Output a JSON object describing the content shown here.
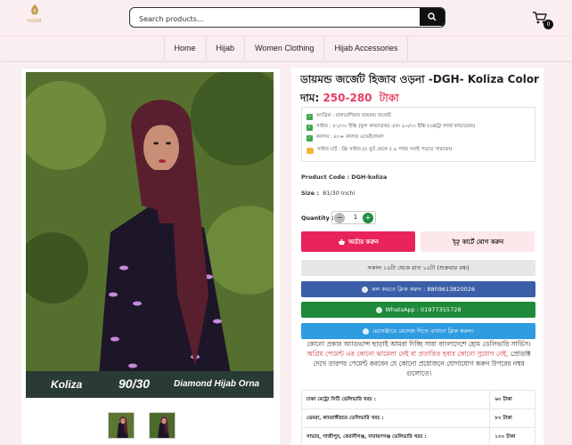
{
  "brand": {
    "logo_text": "HIJAB"
  },
  "search": {
    "placeholder": "Search products..."
  },
  "cart": {
    "count": "0"
  },
  "nav": {
    "items": [
      "Home",
      "Hijab",
      "Women Clothing",
      "Hijab Accessories"
    ]
  },
  "product": {
    "title": "ডায়মন্ড জর্জেট হিজাব ওড়না -DGH- Koliza Color",
    "price_label": "দাম:",
    "price": "250-280",
    "currency": "টাকা",
    "features": [
      "ফ্যাব্রিক : মালয়েশিয়ান ডায়মন্ড জর্জেট",
      "সাইজ : ৮১/৩০ ইঞ্চি (ফুল কাভারেজ) এবং ৯০/৩০ ইঞ্চি (এক্সট্রা লার্জ কাভারেজ)",
      "কালার : ৪০+ কালার এভেইলেবল"
    ],
    "size_note": "সাইজ চার্ট : ফ্রি সাইজ (৫ ফুট থেকে ৫.৯ পর্যন্ত সবাই পড়তে পারবেন)",
    "product_code_label": "Product Code :",
    "product_code": "DGH-koliza",
    "size_label": "Size :",
    "size_value": "81/30 Inchi",
    "quantity_label": "Quantity :",
    "quantity": "1"
  },
  "image": {
    "caption_left": "Koliza",
    "caption_mid": "90/30",
    "caption_right": "Diamond Hijab Orna"
  },
  "actions": {
    "order": "অর্ডার করুন",
    "add_to_cart": "কার্টে যোগ করুন",
    "hours": "সকাল ১০টা থেকে রাত ১০টা (শুক্রবার বন্ধ)",
    "call": "কল করতে ক্লিক করুন : 8809613820026",
    "whatsapp": "WhatsApp : 01977355728",
    "messenger": "মেসেঞ্জারে মেসেজ দিতে এখানে ক্লিক করুন।"
  },
  "notice": {
    "part1": "কোনো প্রকার অ্যাডভান্স ছাড়াই আমরা দিচ্ছি সারা বাংলাদেশে হোম ডেলিভারি সার্ভিস।",
    "part2": "অগ্রিম পেমেন্ট এর কোনো ঝামেলা নেই বা প্রতারিত হবার কোনো সুযোগ নেই,",
    "part3": "প্রোডাক্ট দেখে তারপর পেমেন্ট করবেন যে কোনো প্রয়োজনে যোগাযোগ করুন উপরের নম্বর গুলোতে।"
  },
  "delivery": [
    {
      "area": "ঢাকা মেট্রো সিটি ডেলিভারি খরচ :",
      "cost": "৬০ টাকা"
    },
    {
      "area": "ডেমরা, কামরাঙ্গীরচর ডেলিভারি খরচ :",
      "cost": "৮০ টাকা"
    },
    {
      "area": "সাভার, গাজীপুর, কেরানীগঞ্জ, নারায়ণগঞ্জ ডেলিভারি খরচ :",
      "cost": "১০০ টাকা"
    }
  ],
  "colors": {
    "accent": "#e8235a",
    "price": "#e53d62",
    "call": "#3b5ea8",
    "whatsapp": "#1f8a3a",
    "messenger": "#2f9be0"
  }
}
